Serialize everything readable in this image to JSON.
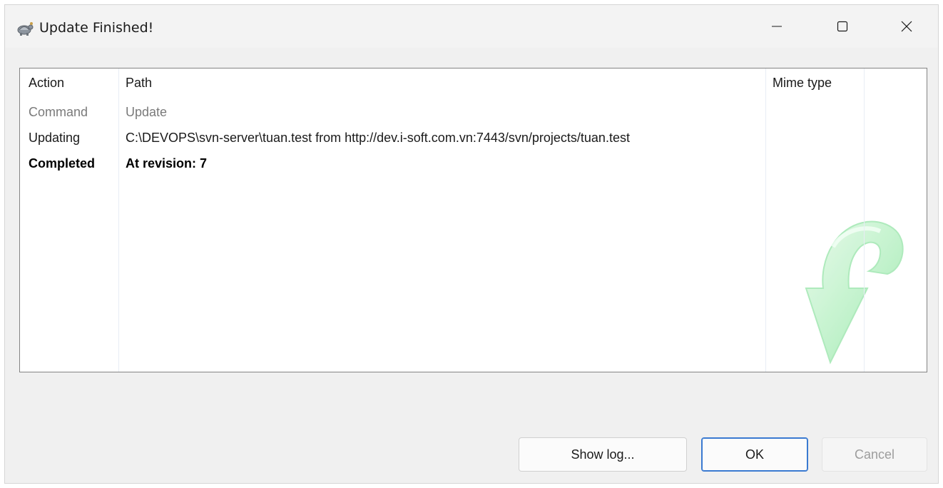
{
  "window": {
    "title": "Update Finished!",
    "icon": "tortoisesvn-icon",
    "controls": [
      "minimize-icon",
      "maximize-icon",
      "close-icon"
    ]
  },
  "table": {
    "columns": [
      "Action",
      "Path",
      "Mime type"
    ],
    "rows": [
      {
        "action": "Command",
        "path": "Update",
        "mime": ""
      },
      {
        "action": "Updating",
        "path": "C:\\DEVOPS\\svn-server\\tuan.test from http://dev.i-soft.com.vn:7443/svn/projects/tuan.test",
        "mime": ""
      },
      {
        "action": "Completed",
        "path": "At revision: 7",
        "mime": ""
      }
    ],
    "watermark_icon": "update-arrow-icon"
  },
  "buttons": {
    "show_log": "Show log...",
    "ok": "OK",
    "cancel": "Cancel"
  },
  "colors": {
    "window_bg": "#f0f0f0",
    "list_bg": "#ffffff",
    "command_text": "#7a7a7a",
    "ok_border": "#3a7ad1",
    "arrow": "#b8f0c4"
  }
}
